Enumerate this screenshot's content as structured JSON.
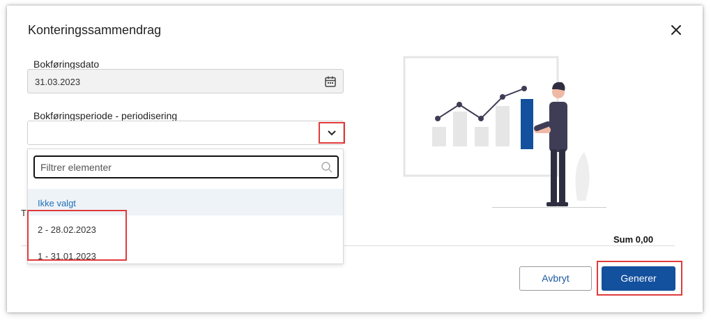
{
  "dialog": {
    "title": "Konteringssammendrag",
    "close_icon": "close-icon"
  },
  "form": {
    "date_label": "Bokføringsdato",
    "date_value": "31.03.2023",
    "date_icon": "calendar-icon",
    "period_label": "Bokføringsperiode - periodisering",
    "period_value": "",
    "period_toggle_icon": "chevron-down-icon"
  },
  "dropdown": {
    "filter_placeholder": "Filtrer elementer",
    "filter_value": "",
    "search_icon": "search-icon",
    "options": [
      {
        "label": "Ikke valgt",
        "selected": true
      },
      {
        "label": "2 - 28.02.2023",
        "selected": false
      },
      {
        "label": "1 - 31.01.2023",
        "selected": false
      }
    ]
  },
  "summary": {
    "obscured_label": "T",
    "sum_text": "Sum 0,00"
  },
  "buttons": {
    "cancel": "Avbryt",
    "generate": "Generer"
  },
  "colors": {
    "primary": "#13509d",
    "link": "#1f6fb5",
    "highlight": "#e03b3b",
    "selected_bg": "#eef3f8"
  }
}
